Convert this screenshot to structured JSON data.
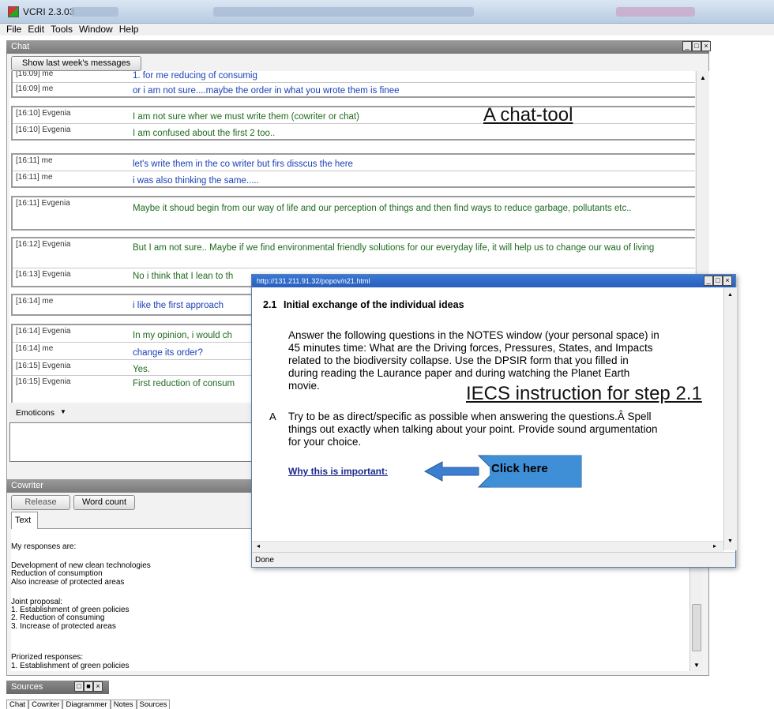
{
  "window": {
    "title": "VCRI 2.3.03"
  },
  "menu": [
    "File",
    "Edit",
    "Tools",
    "Window",
    "Help"
  ],
  "chat": {
    "header": "Chat",
    "show_last_week_label": "Show last week's messages",
    "messages": [
      {
        "who": "[16:09] me",
        "text": "1. for me reducing of consumig",
        "color": "blue"
      },
      {
        "who": "[16:09] me",
        "text": "or i am not sure....maybe the order in what you wrote them is finee",
        "color": "blue"
      },
      {
        "who": "[16:10] Evgenia",
        "text": "I am not sure wher we must write them (cowriter or chat)",
        "color": "green"
      },
      {
        "who": "[16:10] Evgenia",
        "text": "I am confused about the first 2 too..",
        "color": "green"
      },
      {
        "who": "[16:11] me",
        "text": "let's write them in the co writer but firs disscus the here",
        "color": "blue"
      },
      {
        "who": "[16:11] me",
        "text": "i was also thinking the same.....",
        "color": "blue"
      },
      {
        "who": "[16:11] Evgenia",
        "text": "Maybe it shoud begin from our way of life and our perception of things and then find ways to reduce garbage, pollutants etc..",
        "color": "green"
      },
      {
        "who": "[16:12] Evgenia",
        "text": "But I am not sure.. Maybe if we find environmental friendly solutions for our everyday life, it will help us to change our wau of living",
        "color": "green"
      },
      {
        "who": "[16:13] Evgenia",
        "text": "No i think that I lean to th",
        "color": "green"
      },
      {
        "who": "[16:14] me",
        "text": "i like the first approach",
        "color": "blue"
      },
      {
        "who": "[16:14] Evgenia",
        "text": "In my opinion, i would ch",
        "color": "green"
      },
      {
        "who": "[16:14] me",
        "text": "change its order?",
        "color": "blue"
      },
      {
        "who": "[16:15] Evgenia",
        "text": "Yes.",
        "color": "green"
      },
      {
        "who": "[16:15] Evgenia",
        "text": "First reduction of consum",
        "color": "green"
      }
    ],
    "emoticons_label": "Emoticons"
  },
  "annotations": {
    "chat_tool": "A chat-tool",
    "iecs": "IECS instruction for step 2.1",
    "click_here": "Click here"
  },
  "popup": {
    "url": "http://131.211.91.32/popov/n21.html",
    "heading_num": "2.1",
    "heading": "Initial exchange of the individual ideas",
    "para1": "Answer the following questions in the NOTES window (your personal space) in 45 minutes time: What are the Driving forces, Pressures, States, and Impacts related to the biodiversity collapse. Use the DPSIR form that you filled in during reading the Laurance paper and during watching the Planet Earth movie.",
    "bullet_label": "A",
    "para2": "Try to be as direct/specific as possible when answering the questions.Â  Spell things out exactly when talking about your point. Provide sound argumentation for your choice.",
    "link": "Why this is important:",
    "status": "Done"
  },
  "cowriter": {
    "header": "Cowriter",
    "release_label": "Release",
    "wordcount_label": "Word count",
    "tab_label": "Text",
    "lines": [
      "My responses are:",
      "",
      "Development of new clean technologies",
      "Reduction of consumption",
      "Also increase of protected areas",
      "",
      "Joint proposal:",
      "1. Establishment of green policies",
      "2. Reduction of consuming",
      "3. Increase of protected areas",
      "",
      "",
      "Priorized responses:",
      "1. Establishment of green policies"
    ]
  },
  "sources": {
    "header": "Sources"
  },
  "bottom_tabs": [
    "Chat",
    "Cowriter",
    "Diagrammer",
    "Notes",
    "Sources"
  ],
  "colors": {
    "blue_text": "#1a3fb8",
    "green_text": "#1f6a1f",
    "arrow": "#3c7fd0",
    "callout_bg": "#3f8fd6"
  }
}
